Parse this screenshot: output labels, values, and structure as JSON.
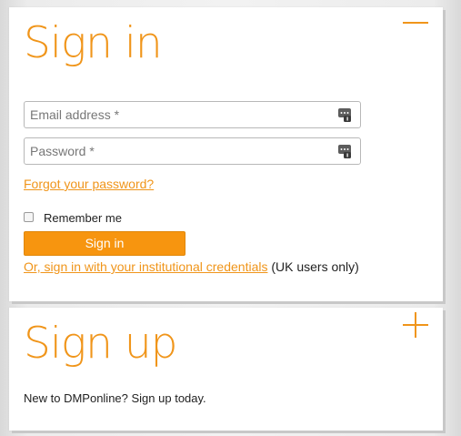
{
  "signin": {
    "title": "Sign in",
    "toggle_icon": "minus-icon",
    "email": {
      "placeholder": "Email address *",
      "value": "",
      "icon": "key-icon"
    },
    "password": {
      "placeholder": "Password *",
      "value": "",
      "icon": "key-icon"
    },
    "forgot_password": "Forgot your password?",
    "remember_me": {
      "label": "Remember me",
      "checked": false
    },
    "button_label": "Sign in",
    "institutional_link": "Or, sign in with your institutional credentials",
    "institutional_note": "(UK users only)"
  },
  "signup": {
    "title": "Sign up",
    "toggle_icon": "plus-icon",
    "text": "New to DMPonline? Sign up today."
  },
  "colors": {
    "accent": "#f0951a",
    "button": "#f7950f"
  }
}
